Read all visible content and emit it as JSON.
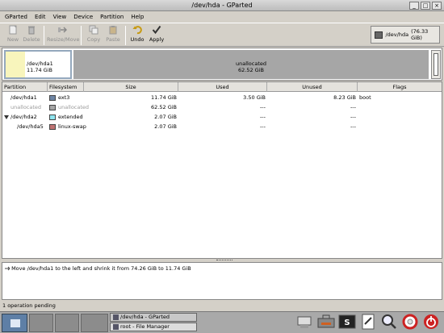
{
  "window": {
    "title": "/dev/hda - GParted",
    "controls": [
      "_",
      "□",
      "×"
    ]
  },
  "menu": [
    "GParted",
    "Edit",
    "View",
    "Device",
    "Partition",
    "Help"
  ],
  "toolbar": {
    "new": "New",
    "delete": "Delete",
    "resize_move": "Resize/Move",
    "copy": "Copy",
    "paste": "Paste",
    "undo": "Undo",
    "apply": "Apply"
  },
  "device_selector": {
    "device": "/dev/hda",
    "size": "(76.33 GiB)"
  },
  "disk_map": {
    "partition": {
      "name": "/dev/hda1",
      "size": "11.74 GiB"
    },
    "unallocated": {
      "name": "unallocated",
      "size": "62.52 GiB"
    }
  },
  "columns": [
    "Partition",
    "Filesystem",
    "Size",
    "Used",
    "Unused",
    "Flags"
  ],
  "rows": [
    {
      "partition": "/dev/hda1",
      "filesystem": "ext3",
      "size": "11.74 GiB",
      "used": "3.50 GiB",
      "unused": "8.23 GiB",
      "flags": "boot",
      "color": "#6f86a5"
    },
    {
      "partition": "unallocated",
      "filesystem": "unallocated",
      "size": "62.52 GiB",
      "used": "---",
      "unused": "---",
      "flags": "",
      "color": "#a6a6a6"
    },
    {
      "partition": "/dev/hda2",
      "filesystem": "extended",
      "size": "2.07 GiB",
      "used": "---",
      "unused": "---",
      "flags": "",
      "color": "#8fe5ef"
    },
    {
      "partition": "/dev/hda5",
      "filesystem": "linux-swap",
      "size": "2.07 GiB",
      "used": "---",
      "unused": "---",
      "flags": "",
      "color": "#c07474"
    }
  ],
  "operations": [
    "Move /dev/hda1 to the left and shrink it from 74.26 GiB to 11.74 GiB"
  ],
  "status": "1 operation pending",
  "taskbar": {
    "tasks": [
      "/dev/hda - GParted",
      "root - File Manager"
    ]
  }
}
